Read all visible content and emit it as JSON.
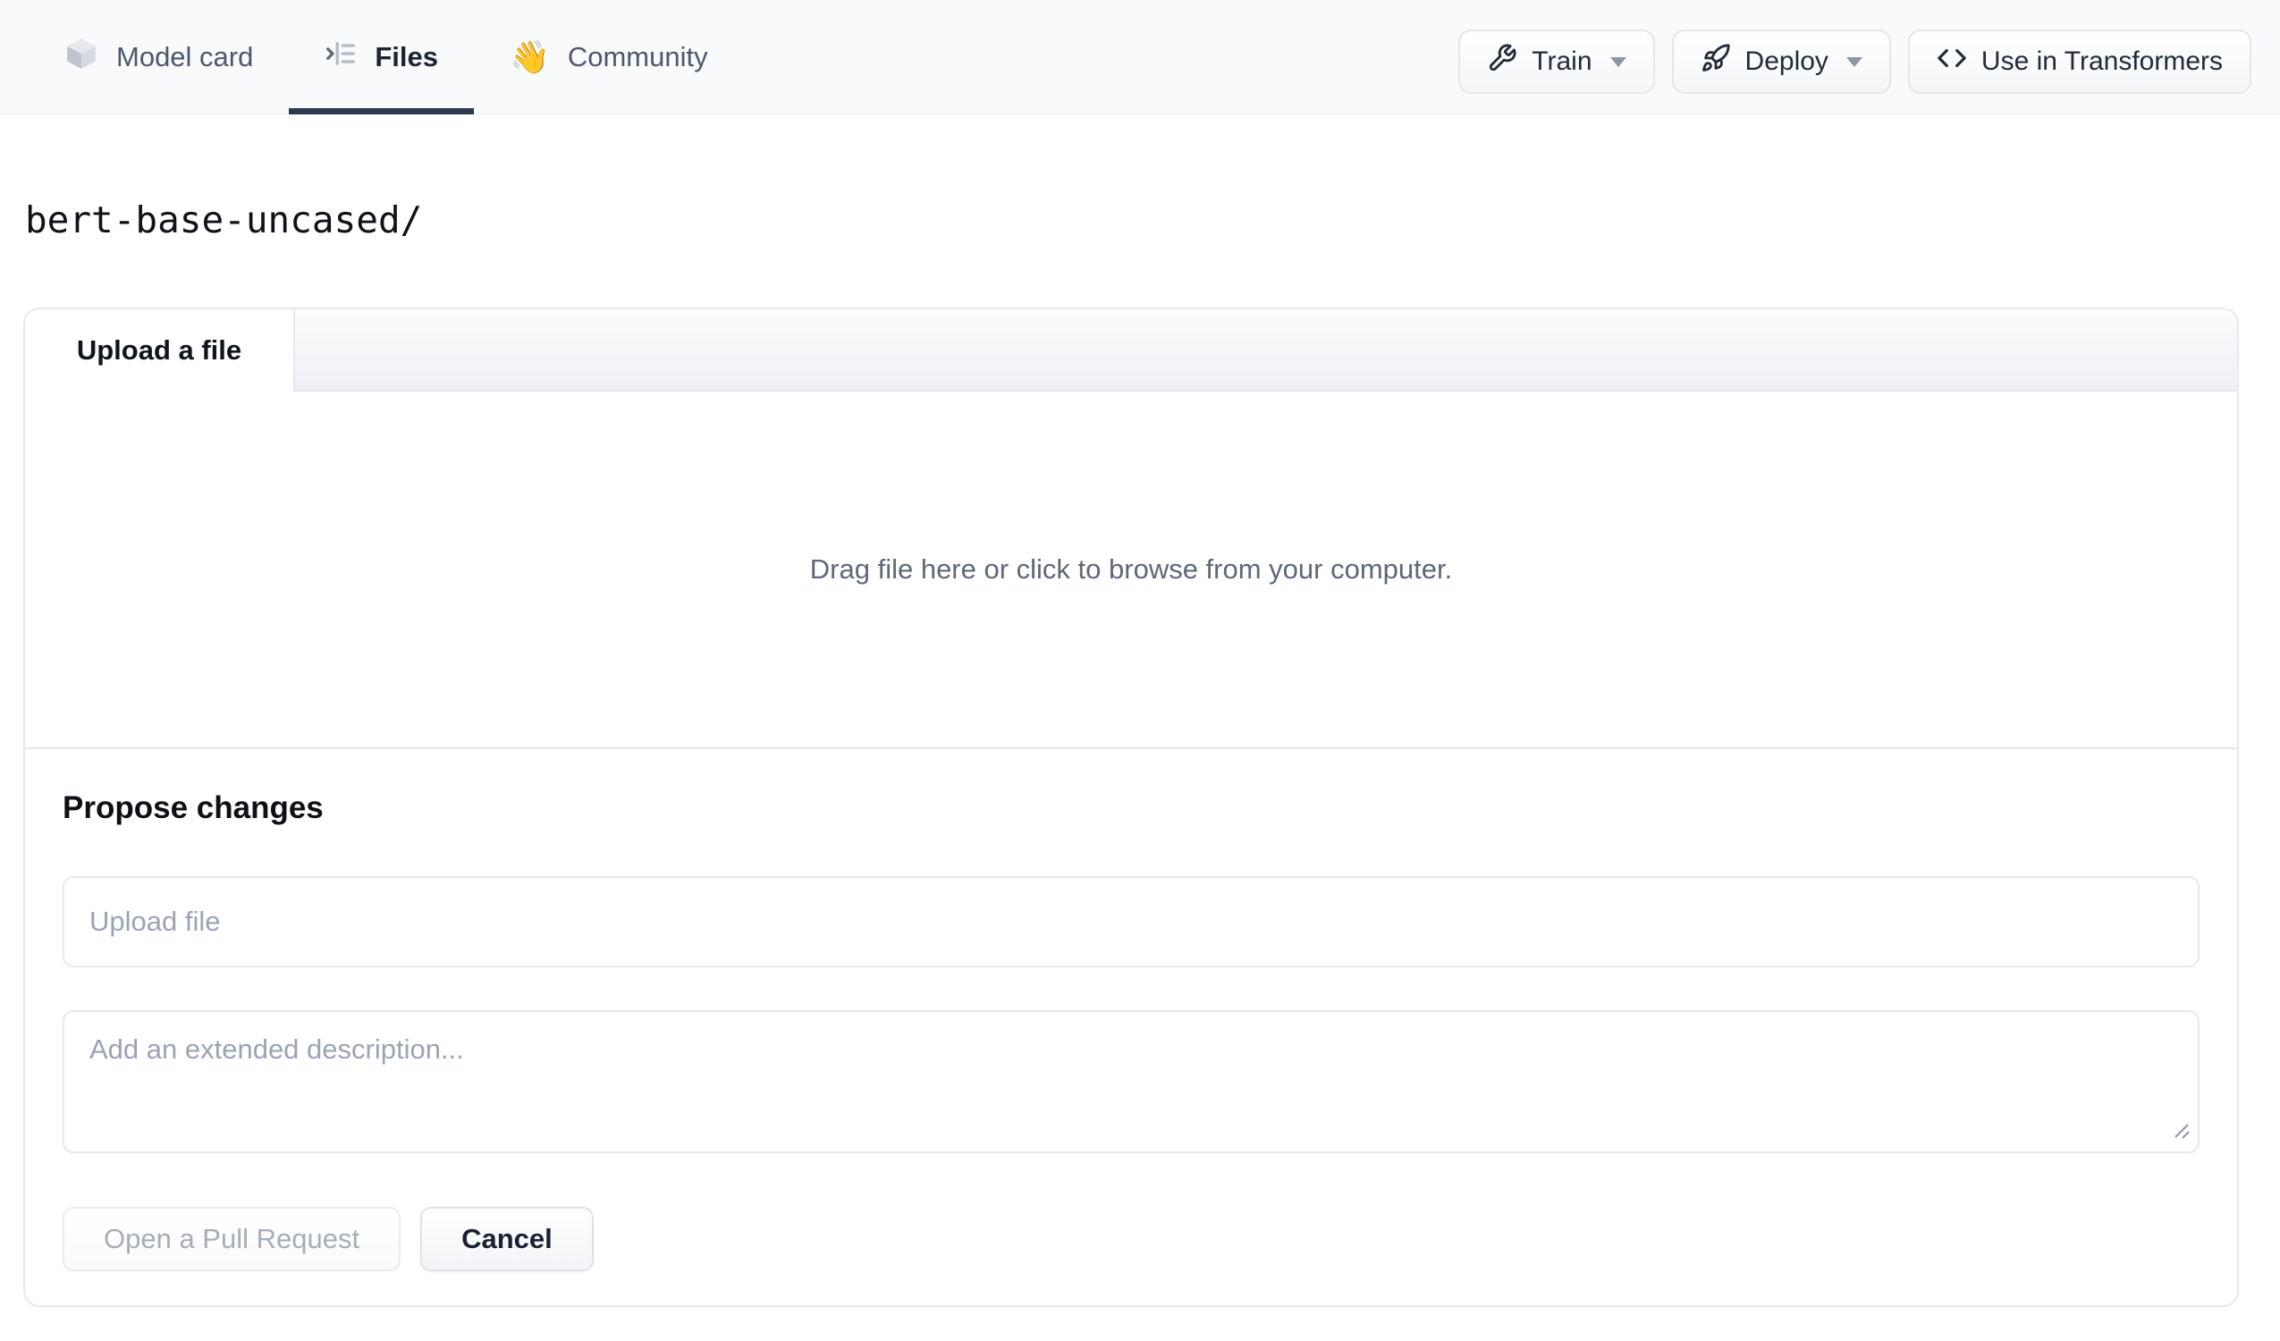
{
  "nav": {
    "tabs": [
      {
        "label": "Model card",
        "icon": "cube-icon",
        "active": false
      },
      {
        "label": "Files",
        "icon": "file-versions-icon",
        "active": true
      },
      {
        "label": "Community",
        "icon": "waving-hand-emoji",
        "emoji": "👋",
        "active": false
      }
    ],
    "actions": [
      {
        "label": "Train",
        "icon": "wrench-icon",
        "dropdown": true
      },
      {
        "label": "Deploy",
        "icon": "rocket-icon",
        "dropdown": true
      },
      {
        "label": "Use in Transformers",
        "icon": "code-icon",
        "dropdown": false
      }
    ]
  },
  "breadcrumb": {
    "repo_path": "bert-base-uncased/"
  },
  "upload_card": {
    "tab_label": "Upload a file",
    "dropzone_text": "Drag file here or click to browse from your computer.",
    "propose_heading": "Propose changes",
    "filename_input": {
      "value": "",
      "placeholder": "Upload file"
    },
    "description_input": {
      "value": "",
      "placeholder": "Add an extended description..."
    },
    "open_pr_label": "Open a Pull Request",
    "cancel_label": "Cancel"
  },
  "colors": {
    "nav_bg": "#f8fafc",
    "active_tab_underline": "#2d3a4d",
    "card_border": "#e6e8ee",
    "muted_text": "#5d6878",
    "placeholder_text": "#9aa4b2",
    "dark_text": "#111827",
    "disabled_text": "#a6adb9"
  }
}
